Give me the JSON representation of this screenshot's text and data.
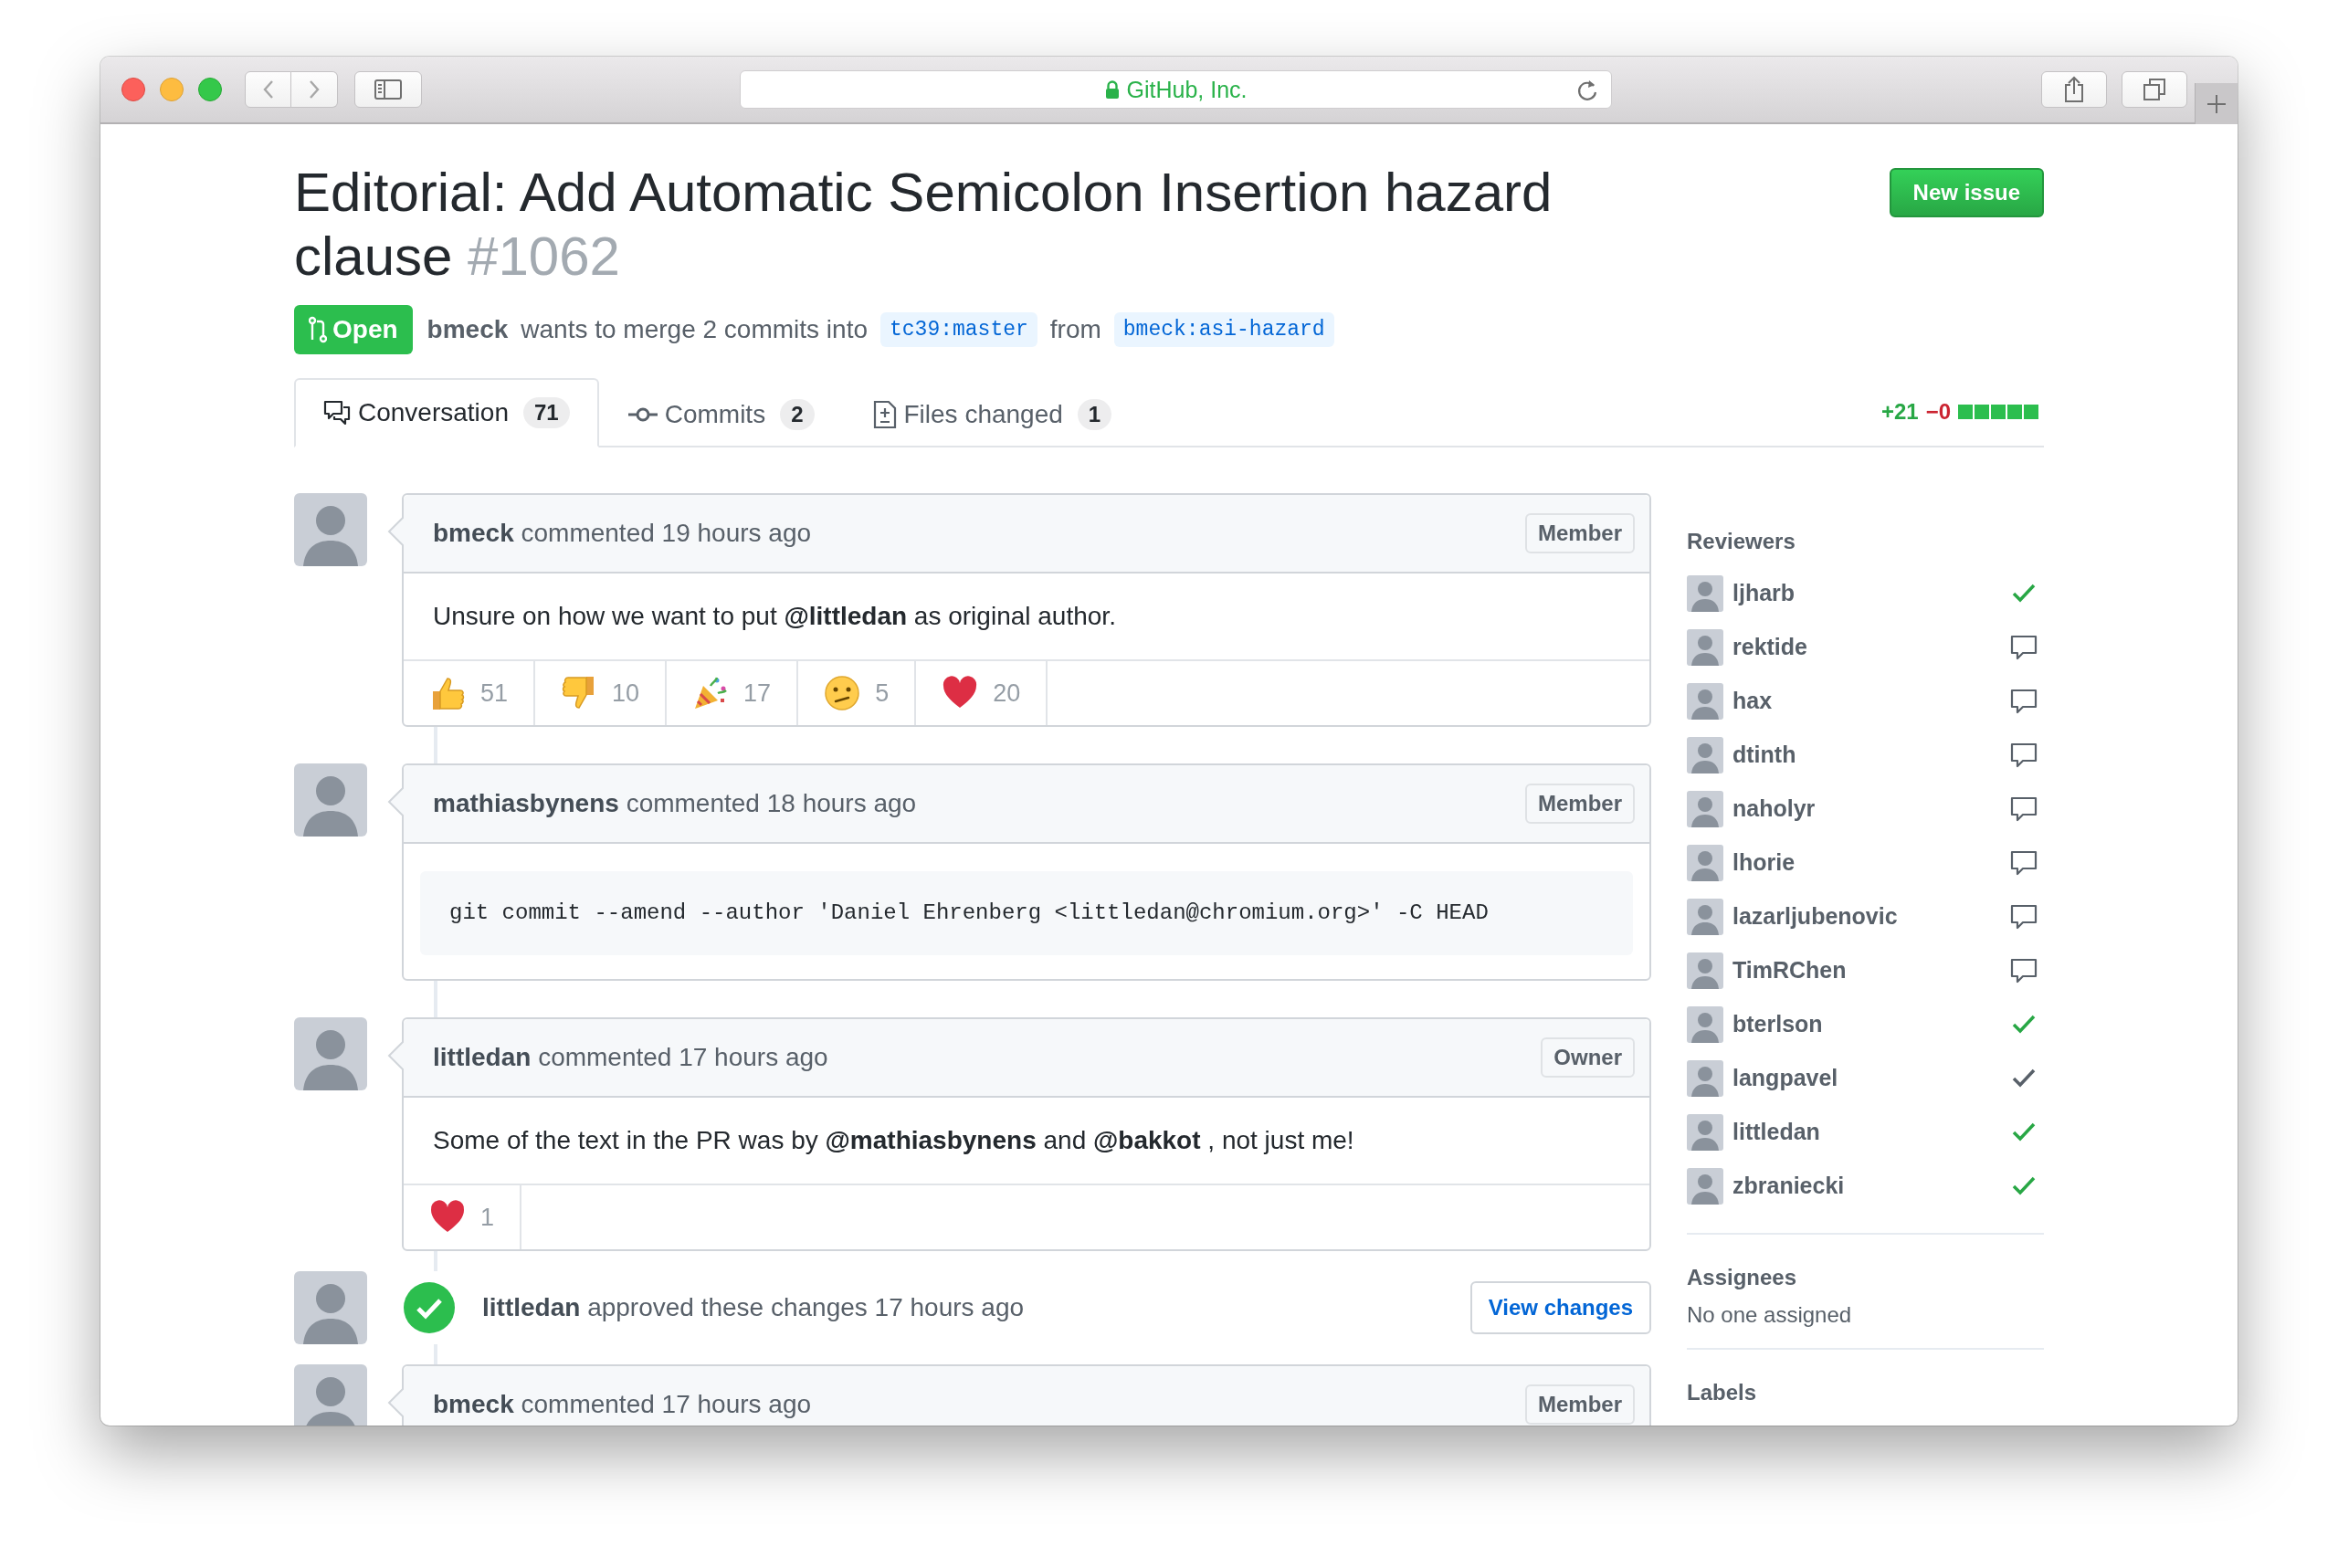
{
  "browser": {
    "address": "GitHub, Inc."
  },
  "pull_request": {
    "title": "Editorial: Add Automatic Semicolon Insertion hazard clause",
    "number": "#1062",
    "state": "Open",
    "author": "bmeck",
    "merge_text": "wants to merge 2 commits into",
    "base_branch": "tc39:master",
    "from_text": "from",
    "head_branch": "bmeck:asi-hazard"
  },
  "new_issue_button": "New issue",
  "tabs": [
    {
      "label": "Conversation",
      "count": "71",
      "selected": true
    },
    {
      "label": "Commits",
      "count": "2",
      "selected": false
    },
    {
      "label": "Files changed",
      "count": "1",
      "selected": false
    }
  ],
  "diffstat": {
    "additions": "+21",
    "deletions": "−0"
  },
  "timeline": [
    {
      "kind": "comment",
      "author": "bmeck",
      "action": "commented 19 hours ago",
      "role": "Member",
      "body": {
        "kind": "text",
        "text": "Unsure on how we want to put **@littledan** as original author."
      },
      "reactions": [
        {
          "kind": "thumbs_up",
          "count": "51"
        },
        {
          "kind": "thumbs_down",
          "count": "10"
        },
        {
          "kind": "hooray",
          "count": "17"
        },
        {
          "kind": "confused",
          "count": "5"
        },
        {
          "kind": "heart",
          "count": "20"
        }
      ]
    },
    {
      "kind": "comment",
      "author": "mathiasbynens",
      "action": "commented 18 hours ago",
      "role": "Member",
      "body": {
        "kind": "code",
        "text": "git commit --amend --author 'Daniel Ehrenberg <littledan@chromium.org>' -C HEAD"
      }
    },
    {
      "kind": "comment",
      "author": "littledan",
      "action": "commented 17 hours ago",
      "role": "Owner",
      "body": {
        "kind": "text",
        "text": "Some of the text in the PR was by **@mathiasbynens** and **@bakkot** , not just me!"
      },
      "reactions": [
        {
          "kind": "heart",
          "count": "1"
        }
      ]
    },
    {
      "kind": "review",
      "author": "littledan",
      "action": "approved these changes 17 hours ago",
      "button": "View changes"
    },
    {
      "kind": "comment",
      "author": "bmeck",
      "action": "commented 17 hours ago",
      "role": "Member"
    }
  ],
  "sidebar": {
    "reviewers": {
      "heading": "Reviewers",
      "items": [
        {
          "name": "ljharb",
          "approved": true,
          "stale": false
        },
        {
          "name": "rektide",
          "approved": false,
          "stale": false
        },
        {
          "name": "hax",
          "approved": false,
          "stale": false
        },
        {
          "name": "dtinth",
          "approved": false,
          "stale": false
        },
        {
          "name": "naholyr",
          "approved": false,
          "stale": false
        },
        {
          "name": "lhorie",
          "approved": false,
          "stale": false
        },
        {
          "name": "lazarljubenovic",
          "approved": false,
          "stale": false
        },
        {
          "name": "TimRChen",
          "approved": false,
          "stale": false
        },
        {
          "name": "bterlson",
          "approved": true,
          "stale": false
        },
        {
          "name": "langpavel",
          "approved": true,
          "stale": true
        },
        {
          "name": "littledan",
          "approved": true,
          "stale": false
        },
        {
          "name": "zbraniecki",
          "approved": true,
          "stale": false
        }
      ]
    },
    "assignees": {
      "heading": "Assignees",
      "text": "No one assigned"
    },
    "labels": {
      "heading": "Labels"
    }
  }
}
